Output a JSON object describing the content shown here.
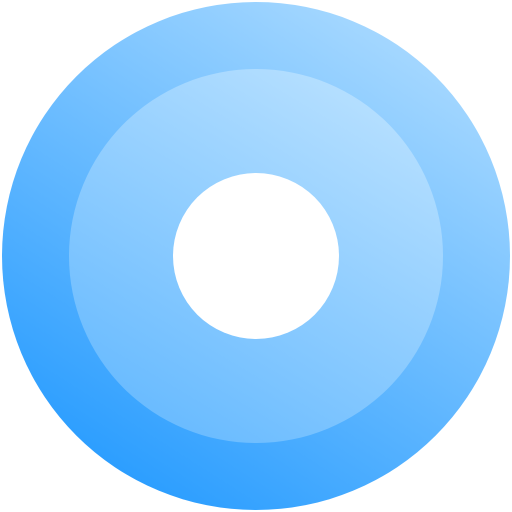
{
  "icon": {
    "name": "ring-target-icon",
    "colors": {
      "outer_light": "#a6d8ff",
      "outer_dark": "#2a9dff",
      "inner_light": "#b3deff",
      "inner_dark": "#6bbcff",
      "center": "#ffffff",
      "background": "#ffffff"
    }
  }
}
